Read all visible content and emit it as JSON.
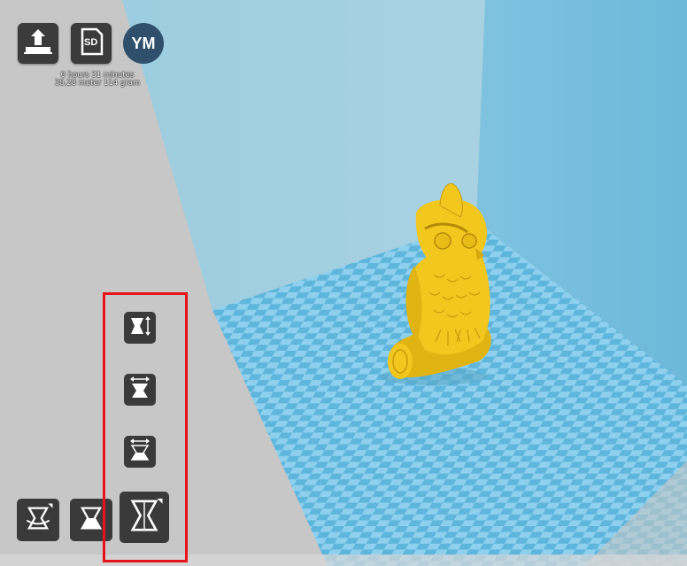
{
  "toolbar": {
    "load_icon": "load-model-icon",
    "sd_label": "SD",
    "user_initials": "YM"
  },
  "print_info": {
    "time": "0 hours 31 minutes",
    "material": "38.28 meter 114 gram"
  },
  "scale_tools": {
    "items": [
      {
        "name": "scale-height-icon"
      },
      {
        "name": "scale-width-top-icon"
      },
      {
        "name": "scale-width-bottom-icon"
      },
      {
        "name": "scale-uniform-icon"
      }
    ]
  },
  "bottom_tools": {
    "items": [
      {
        "name": "rotate-tool-icon"
      },
      {
        "name": "scale-tool-icon"
      },
      {
        "name": "mirror-tool-icon"
      }
    ]
  },
  "colors": {
    "background": "#c7c7c7",
    "build_volume_wall": "#8ecbe3",
    "bed_light": "#8ed0ee",
    "bed_dark": "#5fb6dd",
    "model": "#f2c71e",
    "button": "#3b3b3b",
    "highlight": "#e8141b"
  }
}
